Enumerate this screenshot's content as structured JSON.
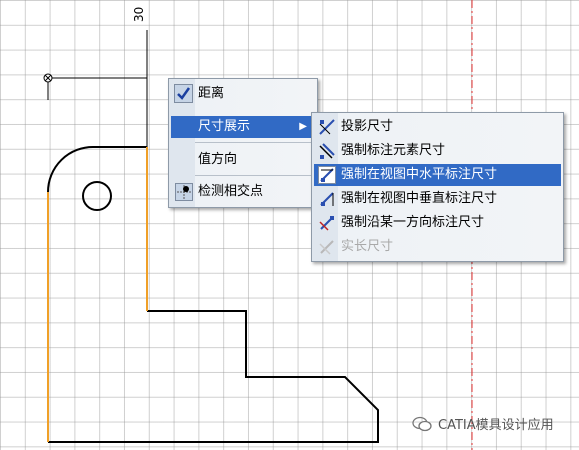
{
  "drawing": {
    "dimension_value": "30",
    "profile_color": "#000000",
    "highlight_color": "#f0a028",
    "axis_color": "#e03030"
  },
  "context_menu": {
    "items": [
      {
        "label": "距离",
        "checked": true,
        "icon": "checkbox-icon"
      },
      {
        "label": "尺寸展示",
        "submenu": true,
        "highlighted": true
      },
      {
        "label": "值方向"
      },
      {
        "label": "检测相交点",
        "icon": "intersection-point-icon"
      }
    ]
  },
  "submenu": {
    "items": [
      {
        "label": "投影尺寸",
        "icon": "projected-dimension-icon"
      },
      {
        "label": "强制标注元素尺寸",
        "icon": "force-element-dimension-icon"
      },
      {
        "label": "强制在视图中水平标注尺寸",
        "icon": "force-horizontal-dimension-icon",
        "highlighted": true
      },
      {
        "label": "强制在视图中垂直标注尺寸",
        "icon": "force-vertical-dimension-icon"
      },
      {
        "label": "强制沿某一方向标注尺寸",
        "icon": "force-direction-dimension-icon"
      },
      {
        "label": "实长尺寸",
        "icon": "true-length-dimension-icon",
        "disabled": true
      }
    ]
  },
  "watermark": {
    "text": "CATIA模具设计应用",
    "icon": "wechat-icon"
  }
}
